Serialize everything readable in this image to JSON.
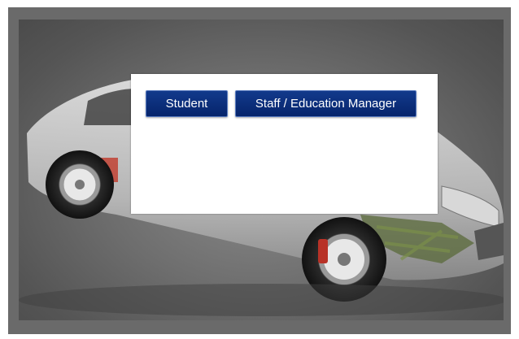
{
  "colors": {
    "frame": "#6a6a6a",
    "button_bg": "#0b2f7d",
    "button_text": "#ffffff",
    "dialog_bg": "#ffffff"
  },
  "dialog": {
    "student_label": "Student",
    "staff_label": "Staff / Education Manager"
  }
}
